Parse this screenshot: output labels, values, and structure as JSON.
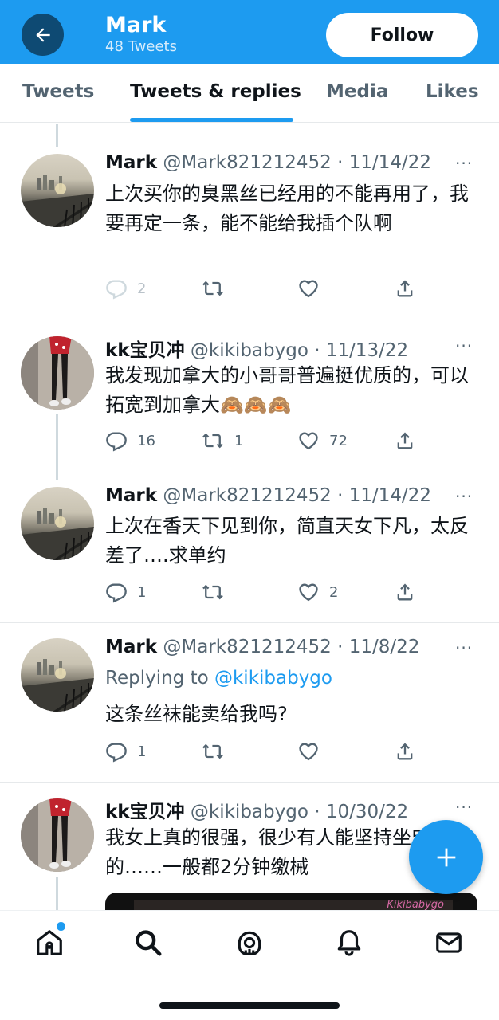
{
  "header": {
    "name": "Mark",
    "tweet_count": "48 Tweets",
    "follow_label": "Follow",
    "back_icon": "arrow-left-icon",
    "bg_color": "#1d9bf0"
  },
  "tabs": [
    {
      "label": "Tweets",
      "active": false
    },
    {
      "label": "Tweets & replies",
      "active": true
    },
    {
      "label": "Media",
      "active": false
    },
    {
      "label": "Likes",
      "active": false
    }
  ],
  "tweets": [
    {
      "name": "Mark",
      "meta": "@Mark821212452 · 11/14/22",
      "text": "上次买你的臭黑丝已经用的不能再用了，我要再定一条，能不能给我插个队啊",
      "replies": "2",
      "retweets": "",
      "likes": ""
    },
    {
      "name": "kk宝贝冲",
      "meta": "@kikibabygo · 11/13/22",
      "text": "我发现加拿大的小哥哥普遍挺优质的，可以拓宽到加拿大🙈🙈🙈",
      "replies": "16",
      "retweets": "1",
      "likes": "72"
    },
    {
      "name": "Mark",
      "meta": "@Mark821212452 · 11/14/22",
      "text": "上次在香天下见到你，简直天女下凡，太反差了….求单约",
      "replies": "1",
      "retweets": "",
      "likes": "2"
    },
    {
      "name": "Mark",
      "meta": "@Mark821212452 · 11/8/22",
      "replying_prefix": "Replying to ",
      "replying_to": "@kikibabygo",
      "text": "这条丝袜能卖给我吗?",
      "replies": "1",
      "retweets": "",
      "likes": ""
    },
    {
      "name": "kk宝贝冲",
      "meta": "@kikibabygo · 10/30/22",
      "text": "我女上真的很强，很少有人能坚持坐5分钟的……一般都2分钟缴械",
      "media_watermark": "Kikibabygo"
    }
  ],
  "more_label": "···",
  "fab_icon": "plus-icon",
  "bottom_nav": [
    "home-icon",
    "search-icon",
    "spaces-icon",
    "notifications-icon",
    "messages-icon"
  ]
}
